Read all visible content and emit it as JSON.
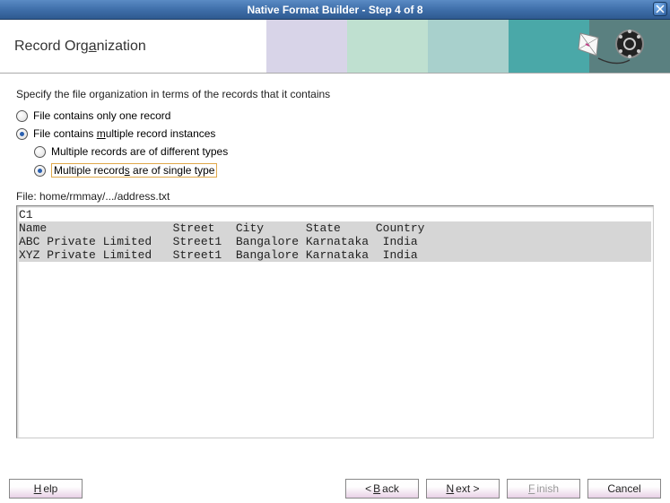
{
  "window": {
    "title": "Native Format Builder - Step 4 of 8"
  },
  "header": {
    "title_pre": "Record Org",
    "title_u": "a",
    "title_post": "nization"
  },
  "instruction": "Specify the file organization in terms of the records that it contains",
  "options": {
    "one_record": {
      "label": "File contains only one record",
      "selected": false
    },
    "multiple": {
      "pre": "File contains ",
      "u": "m",
      "post": "ultiple record instances",
      "selected": true,
      "children": {
        "different": {
          "label": "Multiple records are of different types",
          "selected": false
        },
        "single": {
          "pre": "Multiple record",
          "u": "s",
          "post": " are of single type",
          "selected": true
        }
      }
    }
  },
  "file_path": "File: home/rmmay/.../address.txt",
  "preview": {
    "c1_cell": "C1",
    "header_row": "Name                  Street   City      State     Country",
    "rows": [
      "ABC Private Limited   Street1  Bangalore Karnataka  India",
      "XYZ Private Limited   Street1  Bangalore Karnataka  India"
    ]
  },
  "buttons": {
    "help_u": "H",
    "help_post": "elp",
    "back_pre": "< ",
    "back_u": "B",
    "back_post": "ack",
    "next_u": "N",
    "next_post": "ext >",
    "finish_u": "F",
    "finish_post": "inish",
    "cancel": "Cancel"
  }
}
